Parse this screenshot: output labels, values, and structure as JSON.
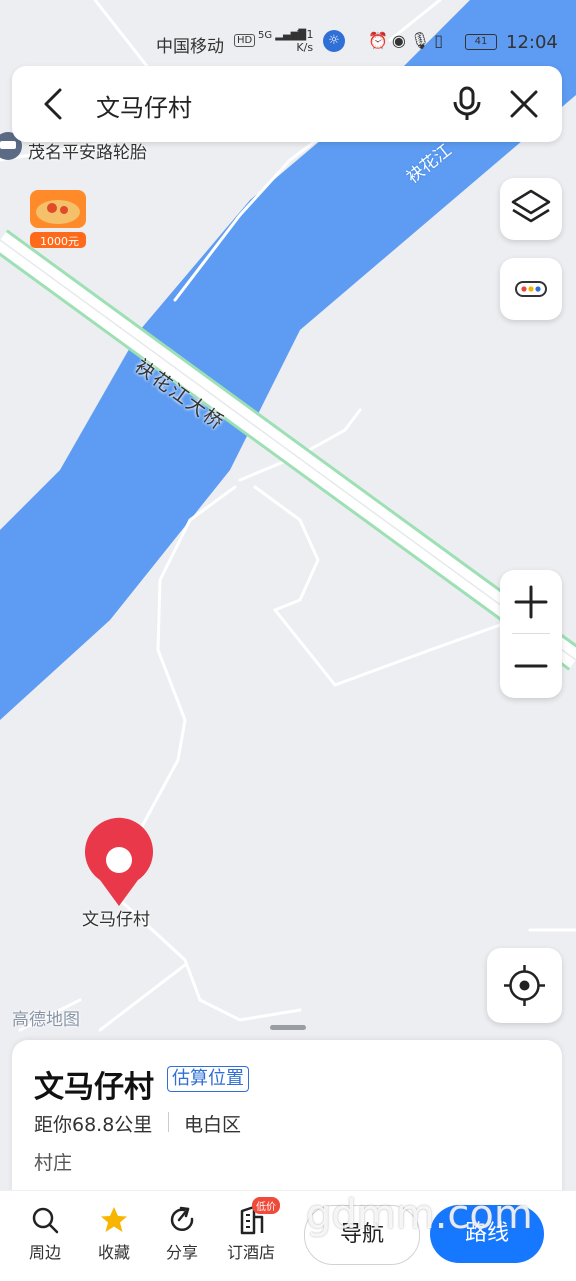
{
  "status_bar": {
    "carrier": "中国移动",
    "hd": "HD",
    "network": "5G",
    "speed_value": "1.1",
    "speed_unit": "K/s",
    "battery": "41",
    "time": "12:04"
  },
  "search": {
    "query": "文马仔村"
  },
  "map": {
    "river_label": "袂花江",
    "bridge_label": "袂花江大桥",
    "poi_label": "茂名平安路轮胎",
    "promo_label": "1000元",
    "marker_label": "文马仔村",
    "watermark": "高德地图",
    "colors": {
      "water": "#5d9cf2",
      "land": "#eceef1",
      "road": "#ffffff",
      "bridge_edge": "#9ce0b4",
      "marker": "#e8384a"
    }
  },
  "place_card": {
    "name": "文马仔村",
    "badge": "估算位置",
    "distance": "距你68.8公里",
    "district": "电白区",
    "category": "村庄"
  },
  "toolbar": {
    "items": [
      {
        "label": "周边",
        "icon": "search-icon"
      },
      {
        "label": "收藏",
        "icon": "star-icon"
      },
      {
        "label": "分享",
        "icon": "share-icon"
      },
      {
        "label": "订酒店",
        "icon": "hotel-icon",
        "badge": "低价"
      }
    ],
    "nav_label": "导航",
    "route_label": "路线",
    "accent": "#1677ff"
  },
  "overlay_watermark": "gdmm.com"
}
